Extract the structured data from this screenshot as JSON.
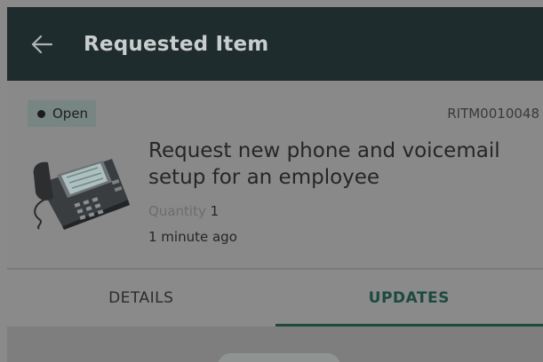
{
  "app_bar": {
    "title": "Requested Item",
    "back_icon": "arrow-left-icon"
  },
  "record": {
    "status": "Open",
    "number": "RITM0010048",
    "title": "Request new phone and voicemail setup for an employee",
    "quantity_label": "Quantity",
    "quantity_value": "1",
    "timestamp": "1 minute ago",
    "image": "ip-desk-phone-image"
  },
  "tabs": [
    {
      "label": "DETAILS",
      "selected": false
    },
    {
      "label": "UPDATES",
      "selected": true
    }
  ],
  "colors": {
    "app_bar_bg": "#1f2c2d",
    "accent": "#1d4a3e",
    "status_badge_bg": "#778683",
    "overlay_bg": "#8a8a8a"
  }
}
